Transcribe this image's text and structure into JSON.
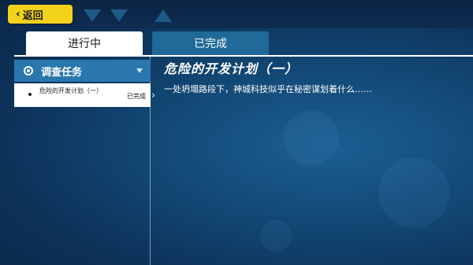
{
  "back_button": {
    "label": "返回",
    "icon": "chevron-left-icon"
  },
  "tabs": [
    {
      "label": "进行中",
      "active": true
    },
    {
      "label": "已完成",
      "active": false
    }
  ],
  "sidebar": {
    "category": {
      "label": "调查任务",
      "icon": "target-icon",
      "expanded": true
    },
    "items": [
      {
        "name": "危险的开发计划（一）",
        "status": "已完成",
        "selected": true
      }
    ]
  },
  "detail": {
    "title": "危险的开发计划（一）",
    "description": "一处坍塌路段下，神城科技似乎在秘密谋划着什么……"
  },
  "colors": {
    "accent_yellow": "#f3d21b",
    "tab_inactive": "#1f6a98",
    "category_bg": "#2a77ad",
    "background_dark": "#0a2748"
  }
}
